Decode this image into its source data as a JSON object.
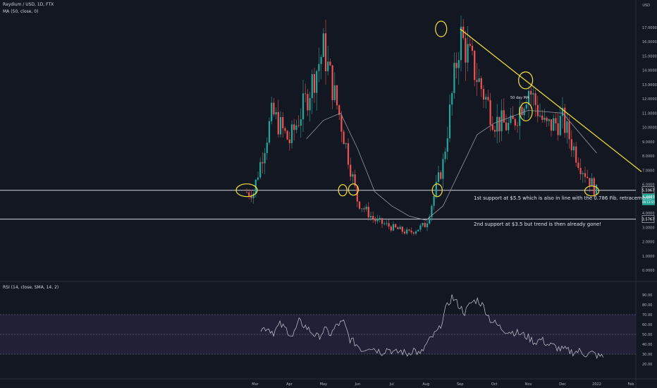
{
  "header": {
    "symbol_line": "Raydium / USD, 1D, FTX",
    "indicator_line": "MA (50, close, 0)",
    "currency": "USD",
    "rsi_label": "RSI (14, close, SMA, 14, 2)"
  },
  "annotations": {
    "support1": "1st support at $5.5 which is also in line with the 0.786 Fib. retracement!",
    "support2": "2nd support at $3.5 but trend is then already gone!",
    "ma_label": "50 day MA"
  },
  "price_badges": {
    "line1": "5.5967",
    "line2": "3.5767",
    "current": "5.4603",
    "current_sub": "06:13:55"
  },
  "colors": {
    "background": "#131722",
    "up": "#26a69a",
    "down": "#ef5350",
    "annotation": "#f5e33b",
    "ma": "#9598a1",
    "rsi": "#c9cbd2",
    "rsi_band": "#2a2540"
  },
  "chart_data": [
    {
      "type": "candlestick",
      "title": "Raydium / USD, 1D, FTX",
      "x_ticks": [
        "Mar",
        "Apr",
        "May",
        "Jun",
        "Jul",
        "Aug",
        "Sep",
        "Oct",
        "Nov",
        "Dec",
        "2022",
        "Feb"
      ],
      "y_ticks": [
        "17.0000",
        "16.0000",
        "15.0000",
        "14.0000",
        "13.0000",
        "12.0000",
        "11.0000",
        "10.0000",
        "9.0000",
        "8.0000",
        "7.0000",
        "6.0000",
        "5.0000",
        "4.0000",
        "3.0000",
        "2.0000",
        "1.0000",
        "0.0000"
      ],
      "ylim": [
        -0.2,
        17.8
      ],
      "close_series": [
        {
          "x": "Mar",
          "y": 6.0
        },
        {
          "x": "Mar-mid",
          "y": 11.0
        },
        {
          "x": "Apr",
          "y": 9.0
        },
        {
          "x": "Apr-mid",
          "y": 12.0
        },
        {
          "x": "May",
          "y": 15.5
        },
        {
          "x": "May-mid",
          "y": 10.5
        },
        {
          "x": "Jun",
          "y": 4.8
        },
        {
          "x": "Jun-mid",
          "y": 3.5
        },
        {
          "x": "Jul",
          "y": 3.0
        },
        {
          "x": "Jul-mid",
          "y": 2.6
        },
        {
          "x": "Aug",
          "y": 3.2
        },
        {
          "x": "Aug-mid",
          "y": 7.5
        },
        {
          "x": "Sep",
          "y": 16.5
        },
        {
          "x": "Sep-mid",
          "y": 13.5
        },
        {
          "x": "Oct",
          "y": 10.5
        },
        {
          "x": "Oct-mid",
          "y": 10.0
        },
        {
          "x": "Nov",
          "y": 12.8
        },
        {
          "x": "Nov-mid",
          "y": 10.0
        },
        {
          "x": "Dec",
          "y": 10.5
        },
        {
          "x": "Dec-mid",
          "y": 7.5
        },
        {
          "x": "2022",
          "y": 5.46
        }
      ],
      "ma_series": [
        {
          "x": "Apr-mid",
          "y": 9.2
        },
        {
          "x": "May",
          "y": 10.5
        },
        {
          "x": "May-mid",
          "y": 11.0
        },
        {
          "x": "Jun",
          "y": 8.5
        },
        {
          "x": "Jun-mid",
          "y": 5.5
        },
        {
          "x": "Jul",
          "y": 4.5
        },
        {
          "x": "Jul-mid",
          "y": 3.8
        },
        {
          "x": "Aug",
          "y": 3.5
        },
        {
          "x": "Aug-mid",
          "y": 4.5
        },
        {
          "x": "Sep",
          "y": 7.0
        },
        {
          "x": "Sep-mid",
          "y": 9.5
        },
        {
          "x": "Oct",
          "y": 10.3
        },
        {
          "x": "Nov",
          "y": 11.2
        },
        {
          "x": "Dec",
          "y": 11.0
        },
        {
          "x": "2022",
          "y": 8.2
        }
      ],
      "support_levels": [
        5.5967,
        3.5767
      ],
      "trendline": [
        {
          "x": "Sep",
          "y": 16.9
        },
        {
          "x": "Feb",
          "y": 6.9
        }
      ],
      "grid": false
    },
    {
      "type": "line",
      "title": "RSI (14, close, SMA, 14, 2)",
      "y_ticks": [
        "90.00",
        "80.00",
        "70.00",
        "60.00",
        "50.00",
        "40.00",
        "30.00",
        "20.00"
      ],
      "ylim": [
        20,
        92
      ],
      "band": [
        30,
        70
      ],
      "series": [
        {
          "values": [
            55,
            57,
            52,
            60,
            55,
            48,
            63,
            58,
            52,
            47,
            55,
            50,
            60,
            62,
            45,
            40,
            34,
            38,
            35,
            32,
            36,
            31,
            33,
            30,
            35,
            29,
            40,
            48,
            55,
            75,
            88,
            80,
            72,
            82,
            85,
            78,
            65,
            60,
            55,
            53,
            52,
            50,
            47,
            42,
            45,
            40,
            38,
            35,
            34,
            32,
            33,
            30,
            31,
            28,
            27
          ]
        }
      ]
    }
  ]
}
